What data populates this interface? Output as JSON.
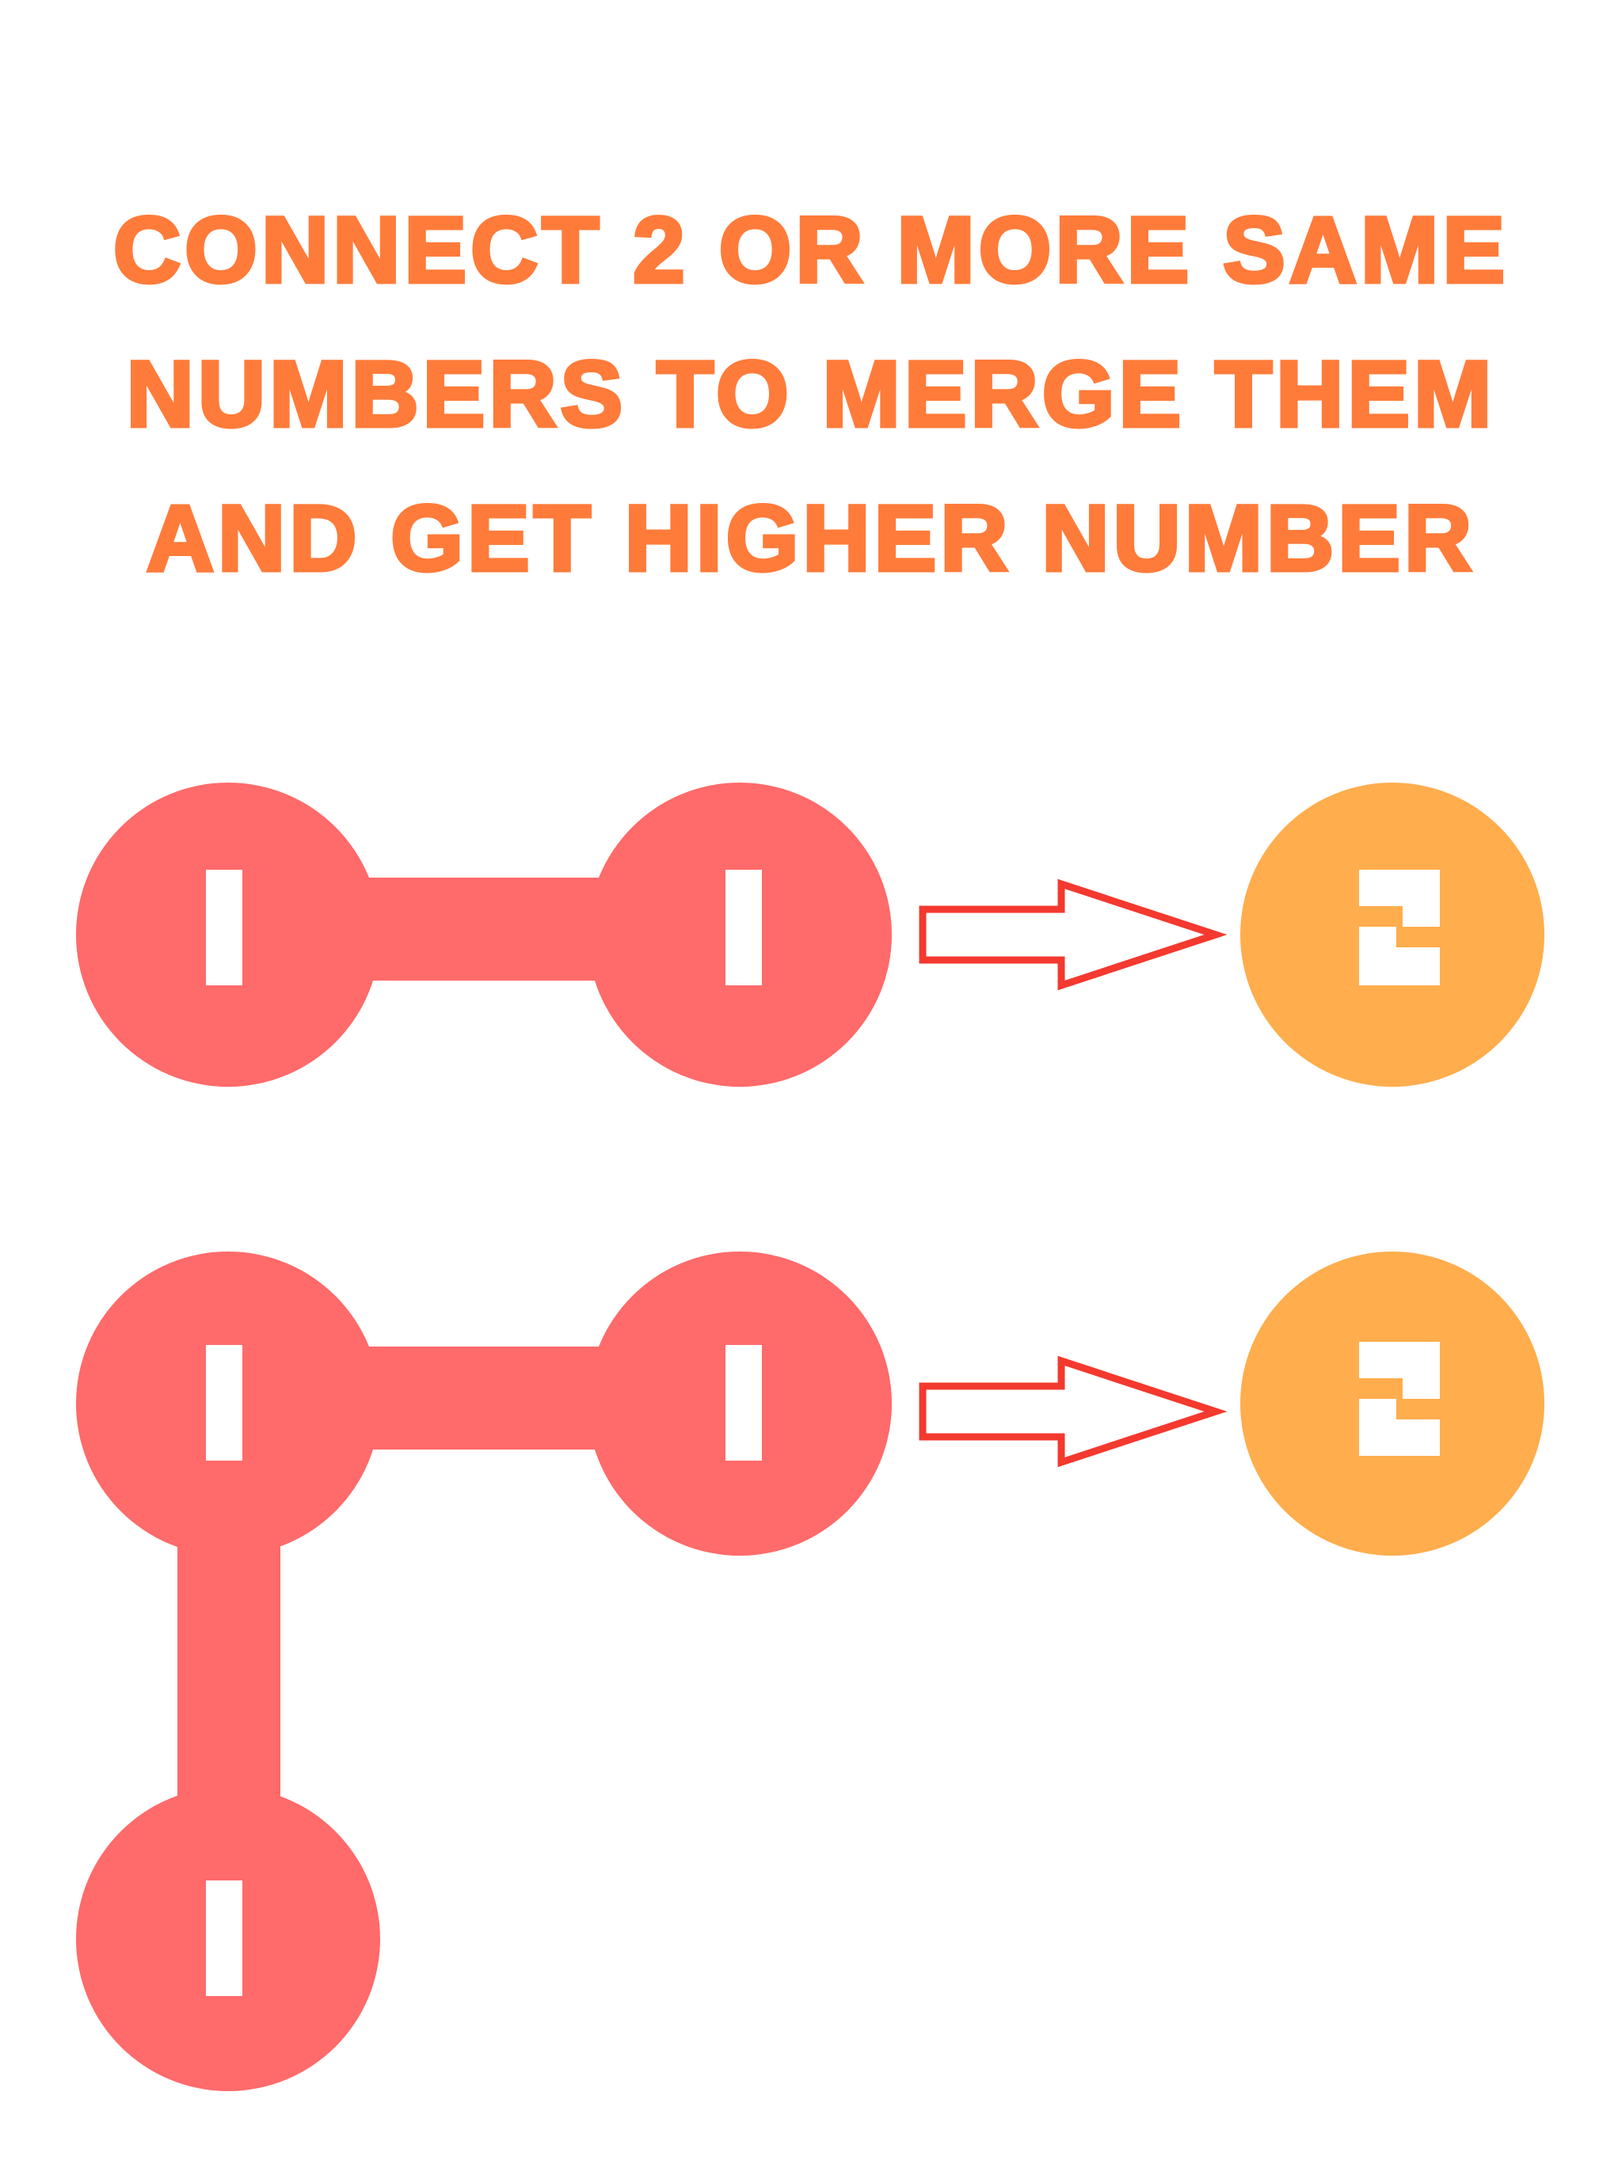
{
  "instructions": {
    "lines": [
      "CONNECT 2 OR MORE SAME",
      "NUMBERS TO MERGE THEM",
      "AND GET HIGHER NUMBER"
    ]
  },
  "colors": {
    "text": "#ff7b3a",
    "tile_one": "#ff6a6a",
    "tile_two": "#ffad4d",
    "arrow": "#f4392f",
    "background": "#ffffff"
  },
  "examples": [
    {
      "source_tiles": [
        "1",
        "1"
      ],
      "result_tile": "2",
      "arrow_icon": "right-arrow-icon"
    },
    {
      "source_tiles": [
        "1",
        "1",
        "1"
      ],
      "result_tile": "2",
      "arrow_icon": "right-arrow-icon"
    }
  ]
}
